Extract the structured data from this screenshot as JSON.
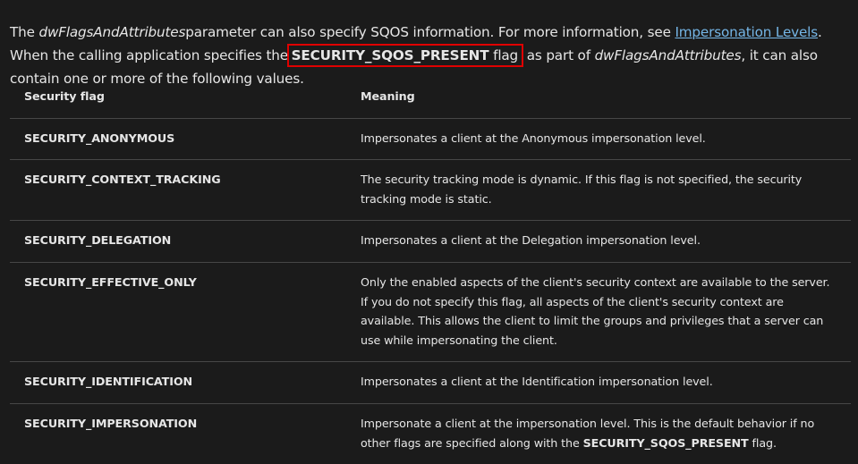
{
  "intro": {
    "part1": "The ",
    "param_name": "dwFlagsAndAttributes",
    "part2": "parameter can also specify SQOS information. For more information, see ",
    "link_text": "Impersonation Levels",
    "part3": ". When the calling application specifies the ",
    "highlighted_flag": "SECURITY_SQOS_PRESENT",
    "flag_suffix": " flag",
    "part4": " as part of ",
    "param_name_2": "dwFlagsAndAttributes",
    "part5": ", it can also contain one or more of the following values.",
    "highlight_color": "#e00000",
    "link_color": "#75b6e7"
  },
  "table": {
    "headers": [
      "Security flag",
      "Meaning"
    ],
    "rows": [
      {
        "flag": "SECURITY_ANONYMOUS",
        "meaning": "Impersonates a client at the Anonymous impersonation level."
      },
      {
        "flag": "SECURITY_CONTEXT_TRACKING",
        "meaning": "The security tracking mode is dynamic. If this flag is not specified, the security tracking mode is static."
      },
      {
        "flag": "SECURITY_DELEGATION",
        "meaning": "Impersonates a client at the Delegation impersonation level."
      },
      {
        "flag": "SECURITY_EFFECTIVE_ONLY",
        "meaning": "Only the enabled aspects of the client's security context are available to the server. If you do not specify this flag, all aspects of the client's security context are available. This allows the client to limit the groups and privileges that a server can use while impersonating the client."
      },
      {
        "flag": "SECURITY_IDENTIFICATION",
        "meaning": "Impersonates a client at the Identification impersonation level."
      },
      {
        "flag": "SECURITY_IMPERSONATION",
        "meaning_prefix": "Impersonate a client at the impersonation level. This is the default behavior if no other flags are specified along with the ",
        "meaning_bold": "SECURITY_SQOS_PRESENT",
        "meaning_suffix": " flag."
      }
    ]
  }
}
